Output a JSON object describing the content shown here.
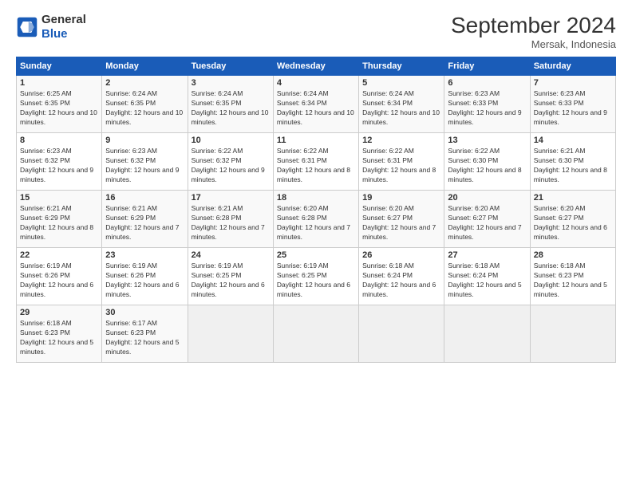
{
  "logo": {
    "line1": "General",
    "line2": "Blue"
  },
  "header": {
    "month": "September 2024",
    "location": "Mersak, Indonesia"
  },
  "weekdays": [
    "Sunday",
    "Monday",
    "Tuesday",
    "Wednesday",
    "Thursday",
    "Friday",
    "Saturday"
  ],
  "weeks": [
    [
      {
        "day": "1",
        "sunrise": "6:25 AM",
        "sunset": "6:35 PM",
        "daylight": "12 hours and 10 minutes."
      },
      {
        "day": "2",
        "sunrise": "6:24 AM",
        "sunset": "6:35 PM",
        "daylight": "12 hours and 10 minutes."
      },
      {
        "day": "3",
        "sunrise": "6:24 AM",
        "sunset": "6:35 PM",
        "daylight": "12 hours and 10 minutes."
      },
      {
        "day": "4",
        "sunrise": "6:24 AM",
        "sunset": "6:34 PM",
        "daylight": "12 hours and 10 minutes."
      },
      {
        "day": "5",
        "sunrise": "6:24 AM",
        "sunset": "6:34 PM",
        "daylight": "12 hours and 10 minutes."
      },
      {
        "day": "6",
        "sunrise": "6:23 AM",
        "sunset": "6:33 PM",
        "daylight": "12 hours and 9 minutes."
      },
      {
        "day": "7",
        "sunrise": "6:23 AM",
        "sunset": "6:33 PM",
        "daylight": "12 hours and 9 minutes."
      }
    ],
    [
      {
        "day": "8",
        "sunrise": "6:23 AM",
        "sunset": "6:32 PM",
        "daylight": "12 hours and 9 minutes."
      },
      {
        "day": "9",
        "sunrise": "6:23 AM",
        "sunset": "6:32 PM",
        "daylight": "12 hours and 9 minutes."
      },
      {
        "day": "10",
        "sunrise": "6:22 AM",
        "sunset": "6:32 PM",
        "daylight": "12 hours and 9 minutes."
      },
      {
        "day": "11",
        "sunrise": "6:22 AM",
        "sunset": "6:31 PM",
        "daylight": "12 hours and 8 minutes."
      },
      {
        "day": "12",
        "sunrise": "6:22 AM",
        "sunset": "6:31 PM",
        "daylight": "12 hours and 8 minutes."
      },
      {
        "day": "13",
        "sunrise": "6:22 AM",
        "sunset": "6:30 PM",
        "daylight": "12 hours and 8 minutes."
      },
      {
        "day": "14",
        "sunrise": "6:21 AM",
        "sunset": "6:30 PM",
        "daylight": "12 hours and 8 minutes."
      }
    ],
    [
      {
        "day": "15",
        "sunrise": "6:21 AM",
        "sunset": "6:29 PM",
        "daylight": "12 hours and 8 minutes."
      },
      {
        "day": "16",
        "sunrise": "6:21 AM",
        "sunset": "6:29 PM",
        "daylight": "12 hours and 7 minutes."
      },
      {
        "day": "17",
        "sunrise": "6:21 AM",
        "sunset": "6:28 PM",
        "daylight": "12 hours and 7 minutes."
      },
      {
        "day": "18",
        "sunrise": "6:20 AM",
        "sunset": "6:28 PM",
        "daylight": "12 hours and 7 minutes."
      },
      {
        "day": "19",
        "sunrise": "6:20 AM",
        "sunset": "6:27 PM",
        "daylight": "12 hours and 7 minutes."
      },
      {
        "day": "20",
        "sunrise": "6:20 AM",
        "sunset": "6:27 PM",
        "daylight": "12 hours and 7 minutes."
      },
      {
        "day": "21",
        "sunrise": "6:20 AM",
        "sunset": "6:27 PM",
        "daylight": "12 hours and 6 minutes."
      }
    ],
    [
      {
        "day": "22",
        "sunrise": "6:19 AM",
        "sunset": "6:26 PM",
        "daylight": "12 hours and 6 minutes."
      },
      {
        "day": "23",
        "sunrise": "6:19 AM",
        "sunset": "6:26 PM",
        "daylight": "12 hours and 6 minutes."
      },
      {
        "day": "24",
        "sunrise": "6:19 AM",
        "sunset": "6:25 PM",
        "daylight": "12 hours and 6 minutes."
      },
      {
        "day": "25",
        "sunrise": "6:19 AM",
        "sunset": "6:25 PM",
        "daylight": "12 hours and 6 minutes."
      },
      {
        "day": "26",
        "sunrise": "6:18 AM",
        "sunset": "6:24 PM",
        "daylight": "12 hours and 6 minutes."
      },
      {
        "day": "27",
        "sunrise": "6:18 AM",
        "sunset": "6:24 PM",
        "daylight": "12 hours and 5 minutes."
      },
      {
        "day": "28",
        "sunrise": "6:18 AM",
        "sunset": "6:23 PM",
        "daylight": "12 hours and 5 minutes."
      }
    ],
    [
      {
        "day": "29",
        "sunrise": "6:18 AM",
        "sunset": "6:23 PM",
        "daylight": "12 hours and 5 minutes."
      },
      {
        "day": "30",
        "sunrise": "6:17 AM",
        "sunset": "6:23 PM",
        "daylight": "12 hours and 5 minutes."
      },
      {
        "day": "",
        "sunrise": "",
        "sunset": "",
        "daylight": ""
      },
      {
        "day": "",
        "sunrise": "",
        "sunset": "",
        "daylight": ""
      },
      {
        "day": "",
        "sunrise": "",
        "sunset": "",
        "daylight": ""
      },
      {
        "day": "",
        "sunrise": "",
        "sunset": "",
        "daylight": ""
      },
      {
        "day": "",
        "sunrise": "",
        "sunset": "",
        "daylight": ""
      }
    ]
  ]
}
